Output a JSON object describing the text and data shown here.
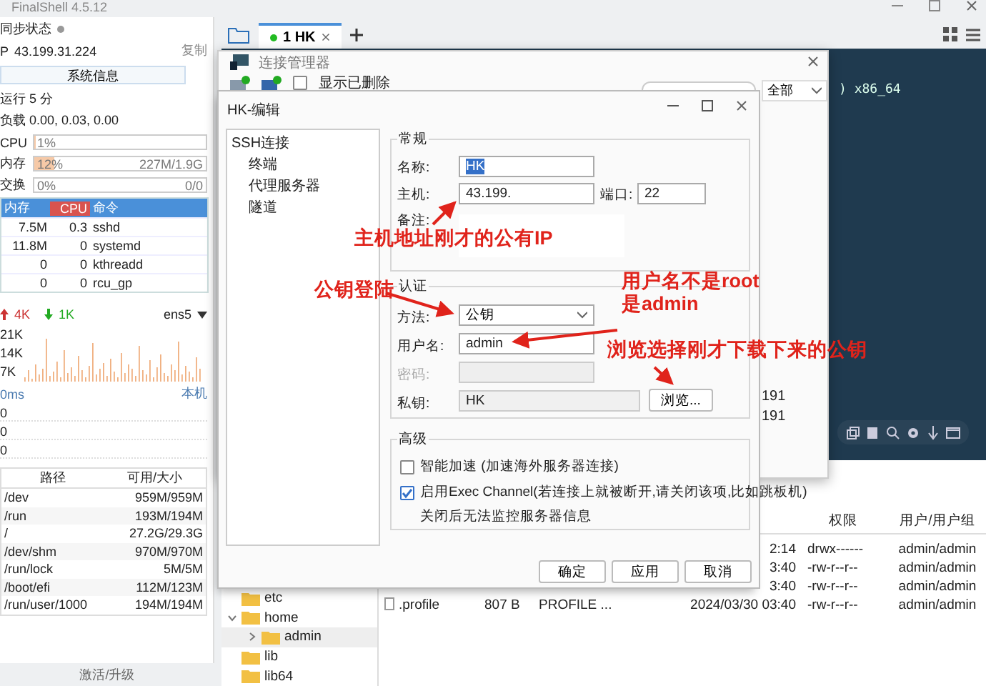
{
  "app": {
    "title": "FinalShell 4.5.12"
  },
  "sidebar": {
    "sync_label": "同步状态",
    "ip_label": "P",
    "ip": "43.199.31.224",
    "copy_link": "复制",
    "sysinfo_button": "系统信息",
    "uptime": "运行 5 分",
    "load": "负载 0.00, 0.03, 0.00",
    "meters": [
      {
        "label": "CPU",
        "level": 0.01,
        "reading": "1%"
      },
      {
        "label": "内存",
        "level": 0.12,
        "reading": "12%",
        "detail": "227M/1.9G"
      },
      {
        "label": "交换",
        "level": 0,
        "reading": "0%",
        "detail": "0/0"
      }
    ],
    "process_table": {
      "columns": [
        {
          "label": "内存",
          "selected": false
        },
        {
          "label": "CPU",
          "selected": true
        },
        {
          "label": "命令",
          "selected": false
        }
      ],
      "rows": [
        [
          "7.5M",
          "0.3",
          "sshd"
        ],
        [
          "11.8M",
          "0",
          "systemd"
        ],
        [
          "0",
          "0",
          "kthreadd"
        ],
        [
          "0",
          "0",
          "rcu_gp"
        ]
      ]
    },
    "network": {
      "upload": "4K",
      "download": "1K",
      "interface": "ens5",
      "y_labels": [
        "21K",
        "14K",
        "7K"
      ]
    },
    "ping": {
      "unit": "0ms",
      "host": "本机",
      "rows": [
        "0",
        "0",
        "0"
      ]
    },
    "disks": {
      "columns": [
        "路径",
        "可用/大小"
      ],
      "rows": [
        [
          "/dev",
          "959M/959M"
        ],
        [
          "/run",
          "193M/194M"
        ],
        [
          "/",
          "27.2G/29.3G"
        ],
        [
          "/dev/shm",
          "970M/970M"
        ],
        [
          "/run/lock",
          "5M/5M"
        ],
        [
          "/boot/efi",
          "112M/123M"
        ],
        [
          "/run/user/1000",
          "194M/194M"
        ]
      ]
    },
    "footer_link": "激活/升级"
  },
  "tabs": [
    {
      "label": "1 HK",
      "selected": true,
      "connected": true
    }
  ],
  "terminal": {
    "lines": [
      ") x86_64"
    ]
  },
  "file_browser": {
    "tree": [
      {
        "name": "etc",
        "selected": false
      },
      {
        "name": "home",
        "selected": false,
        "expanded": true,
        "children": [
          {
            "name": "admin",
            "selected": true,
            "expanded": false
          }
        ]
      },
      {
        "name": "lib",
        "selected": false
      },
      {
        "name": "lib64",
        "selected": false
      }
    ],
    "columns": [
      "权限",
      "用户/用户组"
    ],
    "rows": [
      {
        "time": "2:14",
        "permissions": "drwx------",
        "owner": "admin/admin"
      },
      {
        "time": "3:40",
        "permissions": "-rw-r--r--",
        "owner": "admin/admin"
      },
      {
        "time": "3:40",
        "permissions": "-rw-r--r--",
        "owner": "admin/admin"
      },
      {
        "name": ".profile",
        "size": "807 B",
        "type": "PROFILE ...",
        "time": "2024/03/30 03:40",
        "permissions": "-rw-r--r--",
        "owner": "admin/admin"
      }
    ]
  },
  "connection_manager": {
    "title": "连接管理器",
    "show_deleted": {
      "label": "显示已删除",
      "checked": false
    },
    "filter": "全部",
    "rows": [
      "191",
      "191"
    ]
  },
  "edit_dialog": {
    "title": "HK-编辑",
    "nav": [
      {
        "label": "SSH连接",
        "children": [
          {
            "label": "终端"
          },
          {
            "label": "代理服务器"
          },
          {
            "label": "隧道"
          }
        ]
      }
    ],
    "general": {
      "title": "常规",
      "name_label": "名称:",
      "name": "HK",
      "name_highlighted": true,
      "host_label": "主机:",
      "host": "43.199.",
      "port_label": "端口:",
      "port": "22",
      "note_label": "备注:"
    },
    "auth": {
      "title": "认证",
      "method_label": "方法:",
      "method": "公钥",
      "user_label": "用户名:",
      "user": "admin",
      "password_label": "密码:",
      "password_disabled": true,
      "key_label": "私钥:",
      "key": "HK",
      "browse_button": "浏览..."
    },
    "advanced": {
      "title": "高级",
      "options": [
        {
          "label": "智能加速 (加速海外服务器连接)",
          "checked": false
        },
        {
          "label": "启用Exec Channel(若连接上就被断开,请关闭该项,比如跳板机)",
          "checked": true
        }
      ],
      "note": "关闭后无法监控服务器信息"
    },
    "buttons": [
      "确定",
      "应用",
      "取消"
    ]
  },
  "annotations": [
    {
      "lines": [
        "主机地址刚才的公有IP"
      ]
    },
    {
      "lines": [
        "公钥登陆"
      ]
    },
    {
      "lines": [
        "用户名不是root",
        "是admin"
      ]
    },
    {
      "lines": [
        "浏览选择刚才下载下来的公钥"
      ]
    }
  ]
}
